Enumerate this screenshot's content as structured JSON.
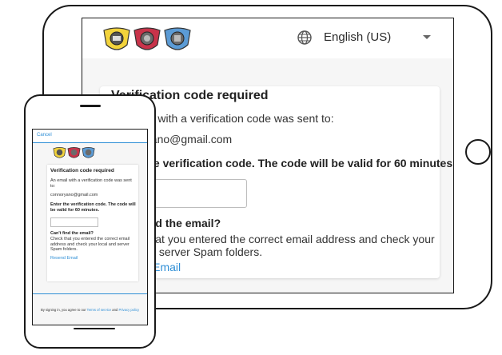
{
  "tablet": {
    "language": "English (US)",
    "card": {
      "title": "Verification code required",
      "sent_text": "An email with a verification code was sent to:",
      "email": "connoryano@gmail.com",
      "instruction": "Enter the verification code. The code will be valid for 60 minutes.",
      "cant_find_heading": "Can't find the email?",
      "cant_find_text": "Check that you entered the correct email address and check your local and server Spam folders.",
      "resend_label": "Resend Email"
    }
  },
  "phone": {
    "cancel_label": "Cancel",
    "card": {
      "title": "Verification code required",
      "sent_text": "An email with a verification code was sent to:",
      "email": "connoryano@gmail.com",
      "instruction": "Enter the verification code. The code will be valid for 60 minutes.",
      "cant_find_heading": "Can't find the email?",
      "cant_find_text": "Check that you entered the correct email address and check your local and server Spam folders.",
      "resend_label": "Resend Email"
    },
    "footer": {
      "prefix": "By signing in, you agree to our",
      "terms_label": "Terms of service",
      "and": "and",
      "privacy_label": "Privacy policy"
    }
  },
  "colors": {
    "accent": "#2f8fd6",
    "badge_yellow": "#f2d33c",
    "badge_red": "#c8334a",
    "badge_blue": "#5b9bd5"
  },
  "icons": [
    "globe-icon",
    "chevron-down-icon",
    "police-badge-icon",
    "fire-badge-icon",
    "ems-badge-icon"
  ]
}
